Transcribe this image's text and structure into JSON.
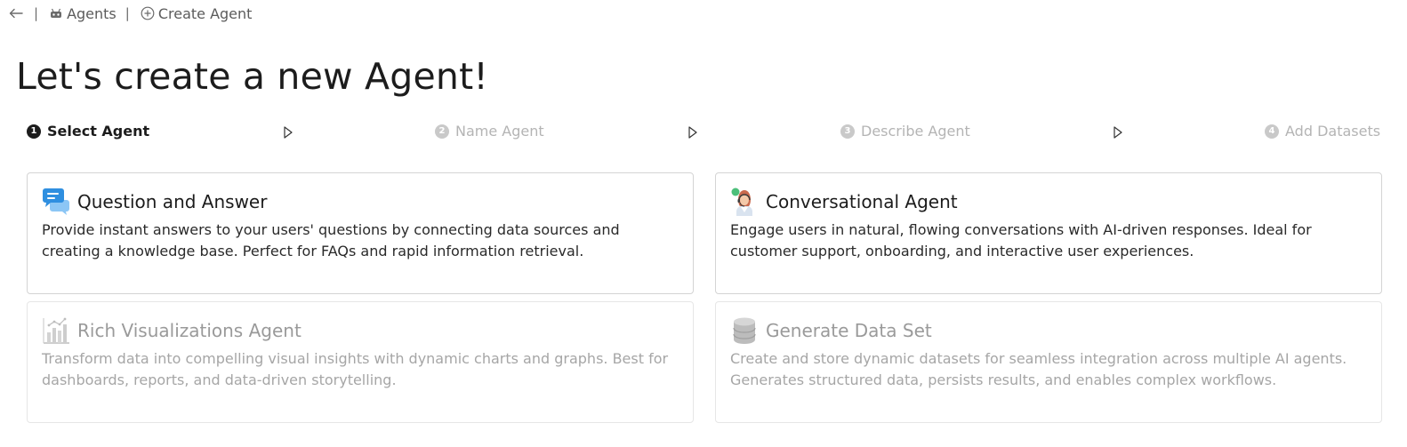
{
  "breadcrumb": {
    "items": [
      {
        "label": "Agents",
        "icon": "robot-icon"
      },
      {
        "label": "Create Agent",
        "icon": "plus-circle-icon"
      }
    ]
  },
  "page_title": "Let's create a new Agent!",
  "stepper": {
    "steps": [
      {
        "number": "1",
        "label": "Select Agent",
        "state": "active"
      },
      {
        "number": "2",
        "label": "Name Agent",
        "state": "inactive"
      },
      {
        "number": "3",
        "label": "Describe Agent",
        "state": "inactive"
      },
      {
        "number": "4",
        "label": "Add Datasets",
        "state": "inactive"
      }
    ]
  },
  "agent_types": [
    {
      "title": "Question and Answer",
      "description": "Provide instant answers to your users' questions by connecting data sources and creating a knowledge base. Perfect for FAQs and rapid information retrieval.",
      "icon": "chat-bubbles-icon",
      "enabled": true
    },
    {
      "title": "Conversational Agent",
      "description": "Engage users in natural, flowing conversations with AI-driven responses. Ideal for customer support, onboarding, and interactive user experiences.",
      "icon": "support-agent-icon",
      "enabled": true
    },
    {
      "title": "Rich Visualizations Agent",
      "description": "Transform data into compelling visual insights with dynamic charts and graphs. Best for dashboards, reports, and data-driven storytelling.",
      "icon": "bar-chart-icon",
      "enabled": false
    },
    {
      "title": "Generate Data Set",
      "description": "Create and store dynamic datasets for seamless integration across multiple AI agents. Generates structured data, persists results, and enables complex workflows.",
      "icon": "database-icon",
      "enabled": false
    }
  ],
  "colors": {
    "active": "#1c1c1c",
    "inactive": "#b4b4b4",
    "chat_icon": "#2f8fe0",
    "border": "#d4d4d4"
  }
}
